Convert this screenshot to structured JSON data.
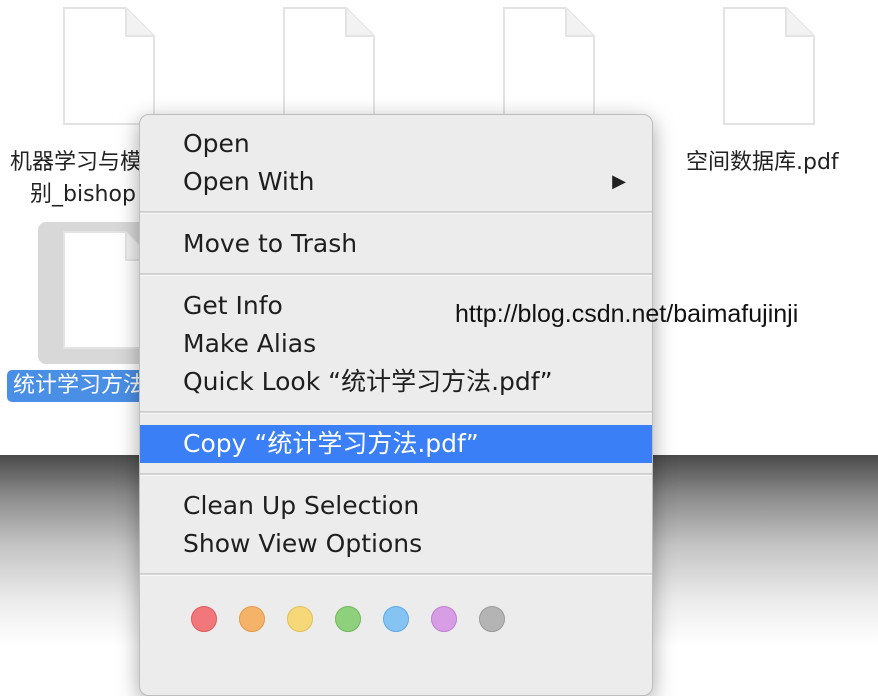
{
  "files": [
    {
      "label_line1": "机器学习与模",
      "label_line2": "别_bishop"
    },
    {
      "label_line1": "",
      "label_line2": ""
    },
    {
      "label_line1": "",
      "label_line2": ""
    },
    {
      "label_line1": "空间数据库.pdf",
      "label_line2": ""
    }
  ],
  "selected_file": {
    "label": "统计学习方法"
  },
  "menu": {
    "open": "Open",
    "open_with": "Open With",
    "open_with_arrow": "▶",
    "move_to_trash": "Move to Trash",
    "get_info": "Get Info",
    "make_alias": "Make Alias",
    "quick_look": "Quick Look “统计学习方法.pdf”",
    "copy": "Copy “统计学习方法.pdf”",
    "clean_up": "Clean Up Selection",
    "show_view_options": "Show View Options"
  },
  "tags": [
    {
      "name": "red",
      "color": "#f2777a",
      "border": "#e05a5e"
    },
    {
      "name": "orange",
      "color": "#f5b36a",
      "border": "#e39a4b"
    },
    {
      "name": "yellow",
      "color": "#f6d878",
      "border": "#e2c05a"
    },
    {
      "name": "green",
      "color": "#8ed07c",
      "border": "#6db85c"
    },
    {
      "name": "blue",
      "color": "#84c3f2",
      "border": "#5fa9e3"
    },
    {
      "name": "purple",
      "color": "#d79ee6",
      "border": "#c07fd2"
    },
    {
      "name": "gray",
      "color": "#b4b4b4",
      "border": "#999999"
    }
  ],
  "watermark": "http://blog.csdn.net/baimafujinji"
}
